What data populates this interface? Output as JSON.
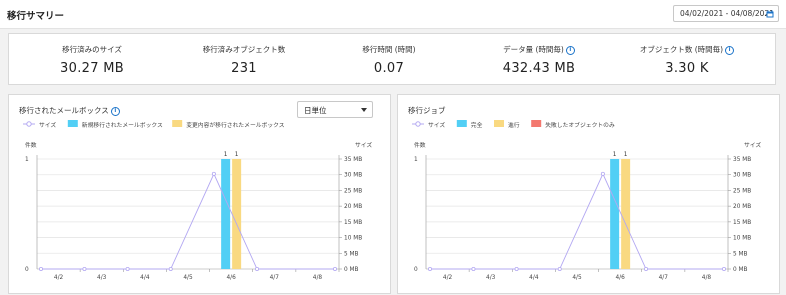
{
  "header": {
    "title": "移行サマリー",
    "date_range": "04/02/2021 - 04/08/2021"
  },
  "summary": [
    {
      "label": "移行済みのサイズ",
      "value": "30.27 MB",
      "info": false
    },
    {
      "label": "移行済みオブジェクト数",
      "value": "231",
      "info": false
    },
    {
      "label": "移行時間 (時間)",
      "value": "0.07",
      "info": false
    },
    {
      "label": "データ量 (時間毎)",
      "value": "432.43 MB",
      "info": true
    },
    {
      "label": "オブジェクト数 (時間毎)",
      "value": "3.30 K",
      "info": true
    }
  ],
  "colors": {
    "blue": "#52cff5",
    "yellow": "#f9d981",
    "red": "#f3786f",
    "line": "#b3a8f2",
    "grid": "#e6e6e6",
    "info": "#1a73c9"
  },
  "left_panel": {
    "title": "移行されたメールボックス",
    "has_info": true,
    "granularity": "日単位"
  },
  "right_panel": {
    "title": "移行ジョブ",
    "has_info": false
  },
  "chart_data": [
    {
      "type": "bar",
      "legend": [
        {
          "name": "サイズ",
          "kind": "line",
          "color": "#b3a8f2"
        },
        {
          "name": "新規移行されたメールボックス",
          "kind": "box",
          "color": "#52cff5"
        },
        {
          "name": "変更内容が移行されたメールボックス",
          "kind": "box",
          "color": "#f9d981"
        }
      ],
      "left_axis_label": "件数",
      "right_axis_label": "サイズ",
      "left_ticks": [
        "1",
        "0"
      ],
      "right_ticks": [
        "35 MB",
        "30 MB",
        "25 MB",
        "20 MB",
        "15 MB",
        "10 MB",
        "5 MB",
        "0 MB"
      ],
      "categories": [
        "4/2",
        "4/3",
        "4/4",
        "4/5",
        "4/6",
        "4/7",
        "4/8"
      ],
      "series": [
        {
          "name": "新規移行されたメールボックス",
          "color": "#52cff5",
          "values": [
            0,
            0,
            0,
            0,
            1,
            0,
            0
          ]
        },
        {
          "name": "変更内容が移行されたメールボックス",
          "color": "#f9d981",
          "values": [
            0,
            0,
            0,
            0,
            1,
            0,
            0
          ]
        }
      ],
      "line": {
        "name": "サイズ",
        "unit": "MB",
        "color": "#b3a8f2",
        "values": [
          0,
          0,
          0,
          0,
          30.27,
          0,
          0
        ]
      },
      "bar_labels": [
        "1",
        "1"
      ],
      "ylim_left": [
        0,
        1
      ],
      "ylim_right": [
        0,
        35
      ]
    },
    {
      "type": "bar",
      "legend": [
        {
          "name": "サイズ",
          "kind": "line",
          "color": "#b3a8f2"
        },
        {
          "name": "完全",
          "kind": "box",
          "color": "#52cff5"
        },
        {
          "name": "進行",
          "kind": "box",
          "color": "#f9d981"
        },
        {
          "name": "失敗したオブジェクトのみ",
          "kind": "box",
          "color": "#f3786f"
        }
      ],
      "left_axis_label": "件数",
      "right_axis_label": "サイズ",
      "left_ticks": [
        "1",
        "0"
      ],
      "right_ticks": [
        "35 MB",
        "30 MB",
        "25 MB",
        "20 MB",
        "15 MB",
        "10 MB",
        "5 MB",
        "0 MB"
      ],
      "categories": [
        "4/2",
        "4/3",
        "4/4",
        "4/5",
        "4/6",
        "4/7",
        "4/8"
      ],
      "series": [
        {
          "name": "完全",
          "color": "#52cff5",
          "values": [
            0,
            0,
            0,
            0,
            1,
            0,
            0
          ]
        },
        {
          "name": "進行",
          "color": "#f9d981",
          "values": [
            0,
            0,
            0,
            0,
            1,
            0,
            0
          ]
        },
        {
          "name": "失敗したオブジェクトのみ",
          "color": "#f3786f",
          "values": [
            0,
            0,
            0,
            0,
            0,
            0,
            0
          ]
        }
      ],
      "line": {
        "name": "サイズ",
        "unit": "MB",
        "color": "#b3a8f2",
        "values": [
          0,
          0,
          0,
          0,
          30.27,
          0,
          0
        ]
      },
      "bar_labels": [
        "1",
        "1"
      ],
      "ylim_left": [
        0,
        1
      ],
      "ylim_right": [
        0,
        35
      ]
    }
  ]
}
